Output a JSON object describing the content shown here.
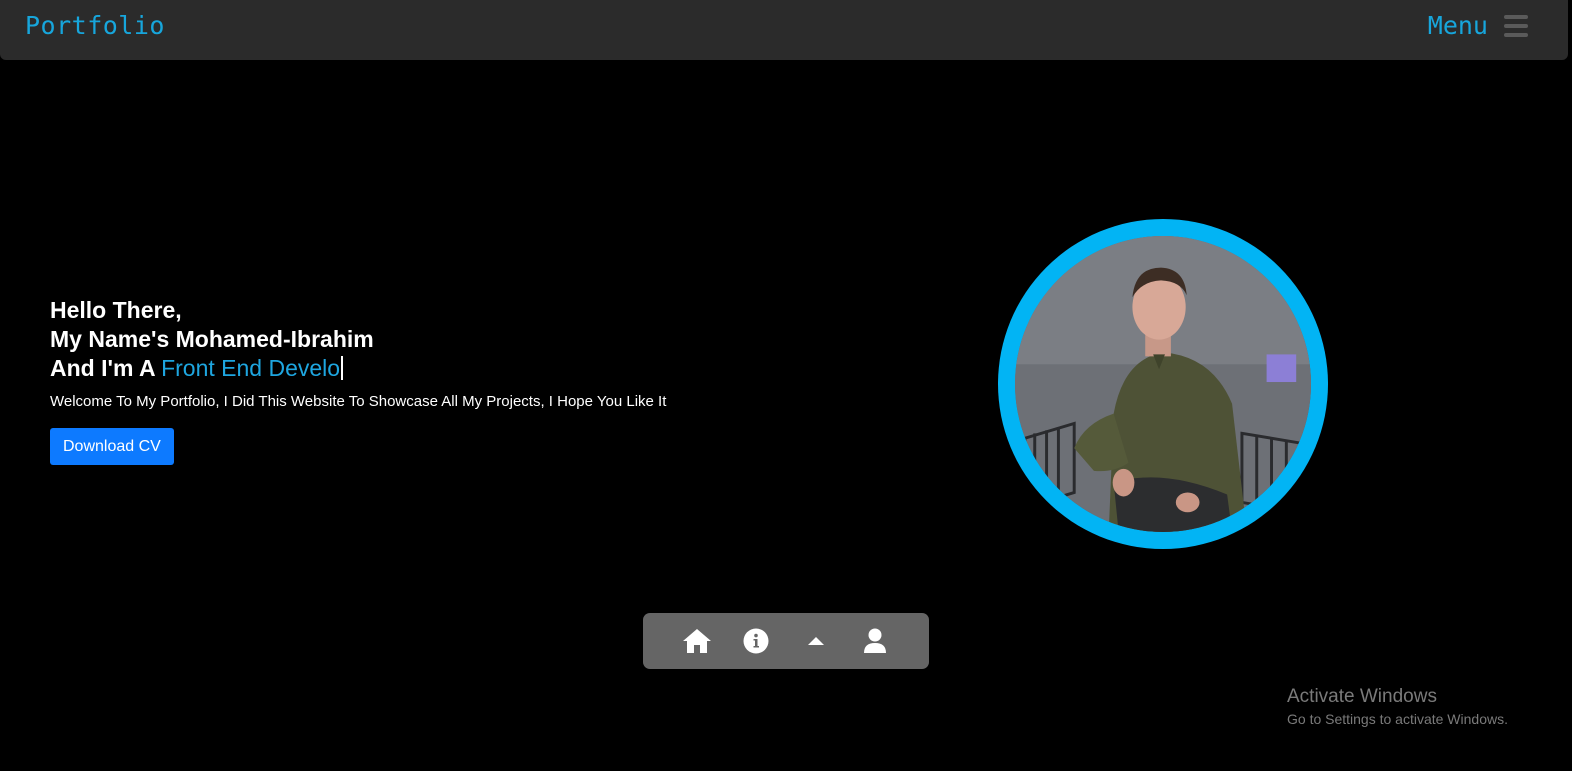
{
  "navbar": {
    "brand": "Portfolio",
    "menu_label": "Menu",
    "menu_icon": "hamburger-icon"
  },
  "hero": {
    "line1": "Hello There,",
    "line2": "My Name's Mohamed-Ibrahim",
    "line3_prefix": "And I'm A ",
    "line3_typed": "Front End Develo",
    "welcome": "Welcome To My Portfolio, I Did This Website To Showcase All My Projects, I Hope You Like It",
    "cv_button": "Download CV"
  },
  "profile_photo": {
    "ring_color": "#02b4f4"
  },
  "dock": {
    "items": [
      {
        "icon": "home-icon"
      },
      {
        "icon": "info-icon"
      },
      {
        "icon": "caret-up-icon"
      },
      {
        "icon": "user-icon"
      }
    ]
  },
  "windows_watermark": {
    "title": "Activate Windows",
    "subtitle": "Go to Settings to activate Windows."
  },
  "colors": {
    "accent": "#17a6dc",
    "button": "#0d7aff",
    "navbar": "#2b2b2b",
    "background": "#000000"
  }
}
